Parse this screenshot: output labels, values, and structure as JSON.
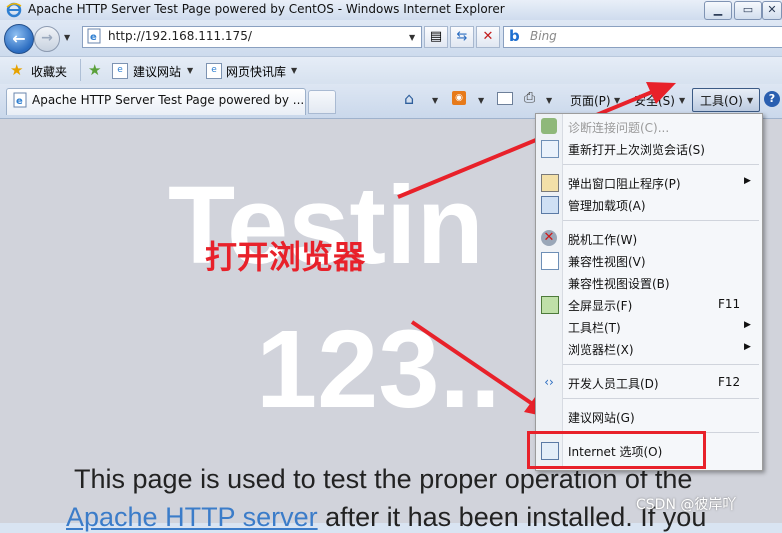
{
  "window": {
    "title": "Apache HTTP Server Test Page powered by CentOS - Windows Internet Explorer",
    "minimize_label": "▁",
    "maximize_label": "▭",
    "close_label": "✕"
  },
  "address_bar": {
    "url": "http://192.168.111.175/"
  },
  "search": {
    "placeholder": "Bing"
  },
  "favorites_bar": {
    "favorites_label": "收藏夹",
    "items": [
      {
        "label": "建议网站"
      },
      {
        "label": "网页快讯库"
      }
    ]
  },
  "tabs": [
    {
      "label": "Apache HTTP Server Test Page powered by ..."
    }
  ],
  "command_bar": {
    "page_label": "页面(P)",
    "safety_label": "安全(S)",
    "tools_label": "工具(O)"
  },
  "page": {
    "heading_line1": "Testin",
    "heading_line2": "123..",
    "para_line1": "This page is used to test the proper operation of the",
    "para_link": "Apache HTTP server",
    "para_line2_rest": " after it has been installed. If you"
  },
  "tools_menu": {
    "items": [
      {
        "label": "诊断连接问题(C)...",
        "disabled": true
      },
      {
        "label": "重新打开上次浏览会话(S)"
      },
      {
        "label": "弹出窗口阻止程序(P)",
        "submenu": true
      },
      {
        "label": "管理加载项(A)"
      },
      {
        "label": "脱机工作(W)"
      },
      {
        "label": "兼容性视图(V)"
      },
      {
        "label": "兼容性视图设置(B)"
      },
      {
        "label": "全屏显示(F)",
        "shortcut": "F11"
      },
      {
        "label": "工具栏(T)",
        "submenu": true
      },
      {
        "label": "浏览器栏(X)",
        "submenu": true
      },
      {
        "label": "开发人员工具(D)",
        "shortcut": "F12"
      },
      {
        "label": "建议网站(G)"
      },
      {
        "label": "Internet 选项(O)"
      }
    ]
  },
  "annotation": {
    "text": "打开浏览器",
    "color": "#e8212a"
  },
  "watermark": "CSDN @彼岸吖",
  "colors": {
    "content_bg": "#d1d3db",
    "link": "#3b7cc9",
    "highlight": "#e8212a"
  }
}
